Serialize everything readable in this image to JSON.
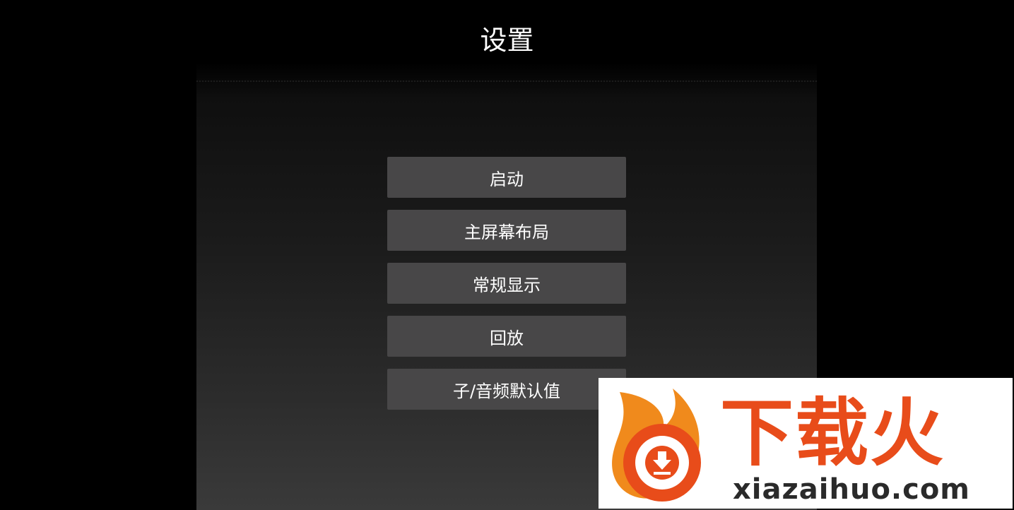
{
  "header": {
    "title": "设置"
  },
  "menu": {
    "items": [
      {
        "label": "启动"
      },
      {
        "label": "主屏幕布局"
      },
      {
        "label": "常规显示"
      },
      {
        "label": "回放"
      },
      {
        "label": "子/音频默认值"
      }
    ]
  },
  "watermark": {
    "brand": "下载火",
    "url": "xiazaihuo.com",
    "icon": "flame-download-logo-icon",
    "colors": {
      "brand": "#e84c1a",
      "flame": "#f08a1c",
      "background": "#ffffff"
    }
  },
  "colors": {
    "background": "#000000",
    "menu_item": "#484748",
    "text": "#ffffff"
  }
}
